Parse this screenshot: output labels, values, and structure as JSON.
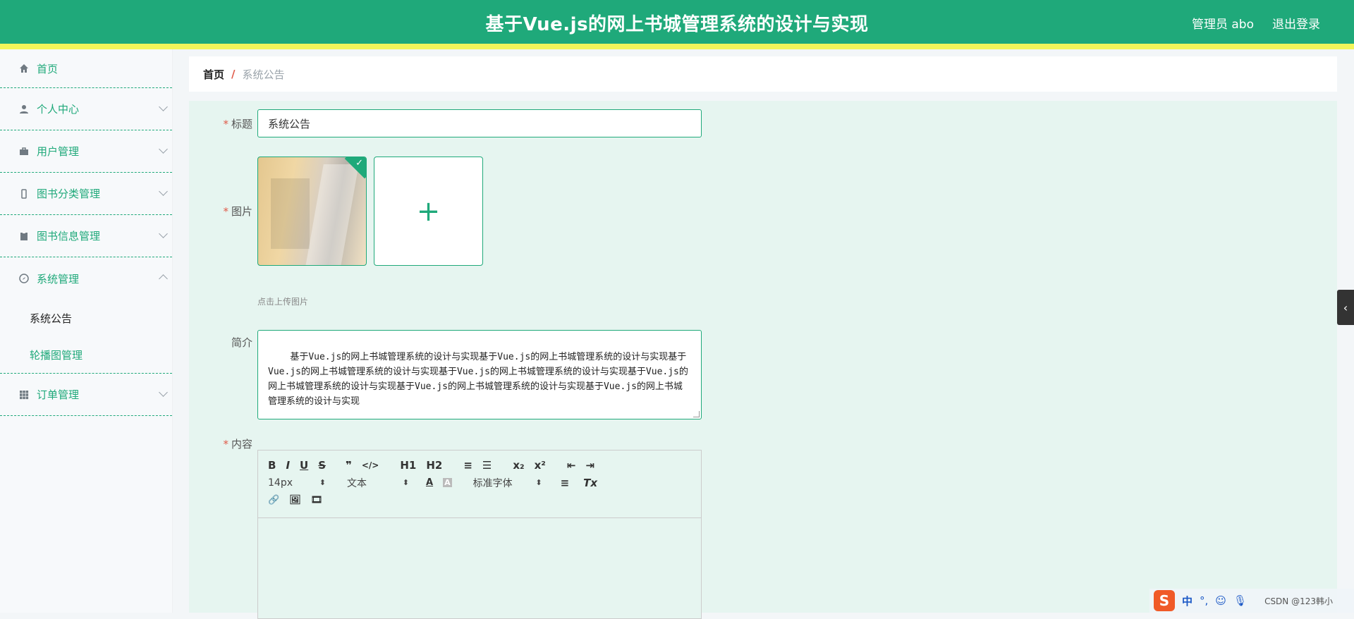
{
  "header": {
    "title": "基于Vue.js的网上书城管理系统的设计与实现",
    "user": "管理员 abo",
    "logout": "退出登录"
  },
  "sidebar": {
    "items": [
      {
        "label": "首页",
        "icon": "home-icon"
      },
      {
        "label": "个人中心",
        "icon": "user-icon"
      },
      {
        "label": "用户管理",
        "icon": "briefcase-icon"
      },
      {
        "label": "图书分类管理",
        "icon": "phone-icon"
      },
      {
        "label": "图书信息管理",
        "icon": "clipboard-icon"
      },
      {
        "label": "系统管理",
        "icon": "compass-icon"
      },
      {
        "label": "订单管理",
        "icon": "grid-icon"
      }
    ],
    "sub": [
      "系统公告",
      "轮播图管理"
    ]
  },
  "breadcrumb": {
    "home": "首页",
    "sep": "/",
    "current": "系统公告"
  },
  "form": {
    "title_label": "标题",
    "title_value": "系统公告",
    "image_label": "图片",
    "upload_plus": "+",
    "upload_hint": "点击上传图片",
    "intro_label": "简介",
    "intro_value": "基于Vue.js的网上书城管理系统的设计与实现基于Vue.js的网上书城管理系统的设计与实现基于Vue.js的网上书城管理系统的设计与实现基于Vue.js的网上书城管理系统的设计与实现基于Vue.js的网上书城管理系统的设计与实现基于Vue.js的网上书城管理系统的设计与实现基于Vue.js的网上书城管理系统的设计与实现",
    "content_label": "内容",
    "required_mark": "*"
  },
  "editor": {
    "row1": [
      "B",
      "I",
      "U",
      "S",
      "❞",
      "</>",
      "H1",
      "H2",
      "≡",
      "☰",
      "x₂",
      "x²",
      "⇤",
      "⇥"
    ],
    "font_size": "14px",
    "block": "文本",
    "font_family": "标准字体",
    "align": "≡",
    "clear": "Tx",
    "color_a": "A",
    "bg_a": "A",
    "row3": [
      "🔗",
      "🖼",
      "🎞"
    ]
  },
  "tray": {
    "ime": "中",
    "csdn": "CSDN @123韩小"
  },
  "colors": {
    "primary": "#1fa97a",
    "accent_yellow": "#f2f55a",
    "required": "#e05b4a"
  }
}
